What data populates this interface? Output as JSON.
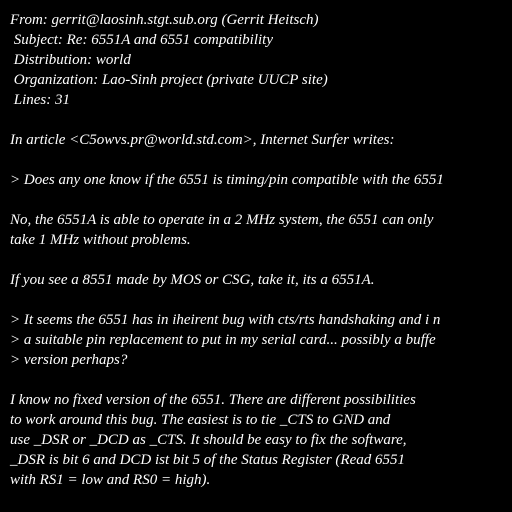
{
  "lines": [
    "From: gerrit@laosinh.stgt.sub.org (Gerrit Heitsch)",
    " Subject: Re: 6551A and 6551 compatibility",
    " Distribution: world",
    " Organization: Lao-Sinh project (private UUCP site)",
    " Lines: 31",
    "",
    "In article <C5owvs.pr@world.std.com>, Internet Surfer writes:",
    "",
    "> Does any one know if the 6551 is timing/pin compatible with the 6551",
    "",
    "No, the 6551A is able to operate in a 2 MHz system, the 6551 can only",
    "take 1 MHz without problems.",
    "",
    "If you see a 8551 made by MOS or CSG, take it, its a 6551A.",
    "",
    "> It seems the 6551 has in iheirent bug with cts/rts handshaking and i n",
    "> a suitable pin replacement to put in my serial card... possibly a buffe",
    "> version perhaps?",
    "",
    "I know no fixed version of the 6551. There are different possibilities",
    "to work around this bug. The easiest is to tie _CTS to GND and",
    "use _DSR or _DCD as _CTS. It should be easy to fix the software,",
    "_DSR is bit 6 and DCD ist bit 5 of the Status Register (Read 6551",
    "with RS1 = low and RS0 = high)."
  ]
}
